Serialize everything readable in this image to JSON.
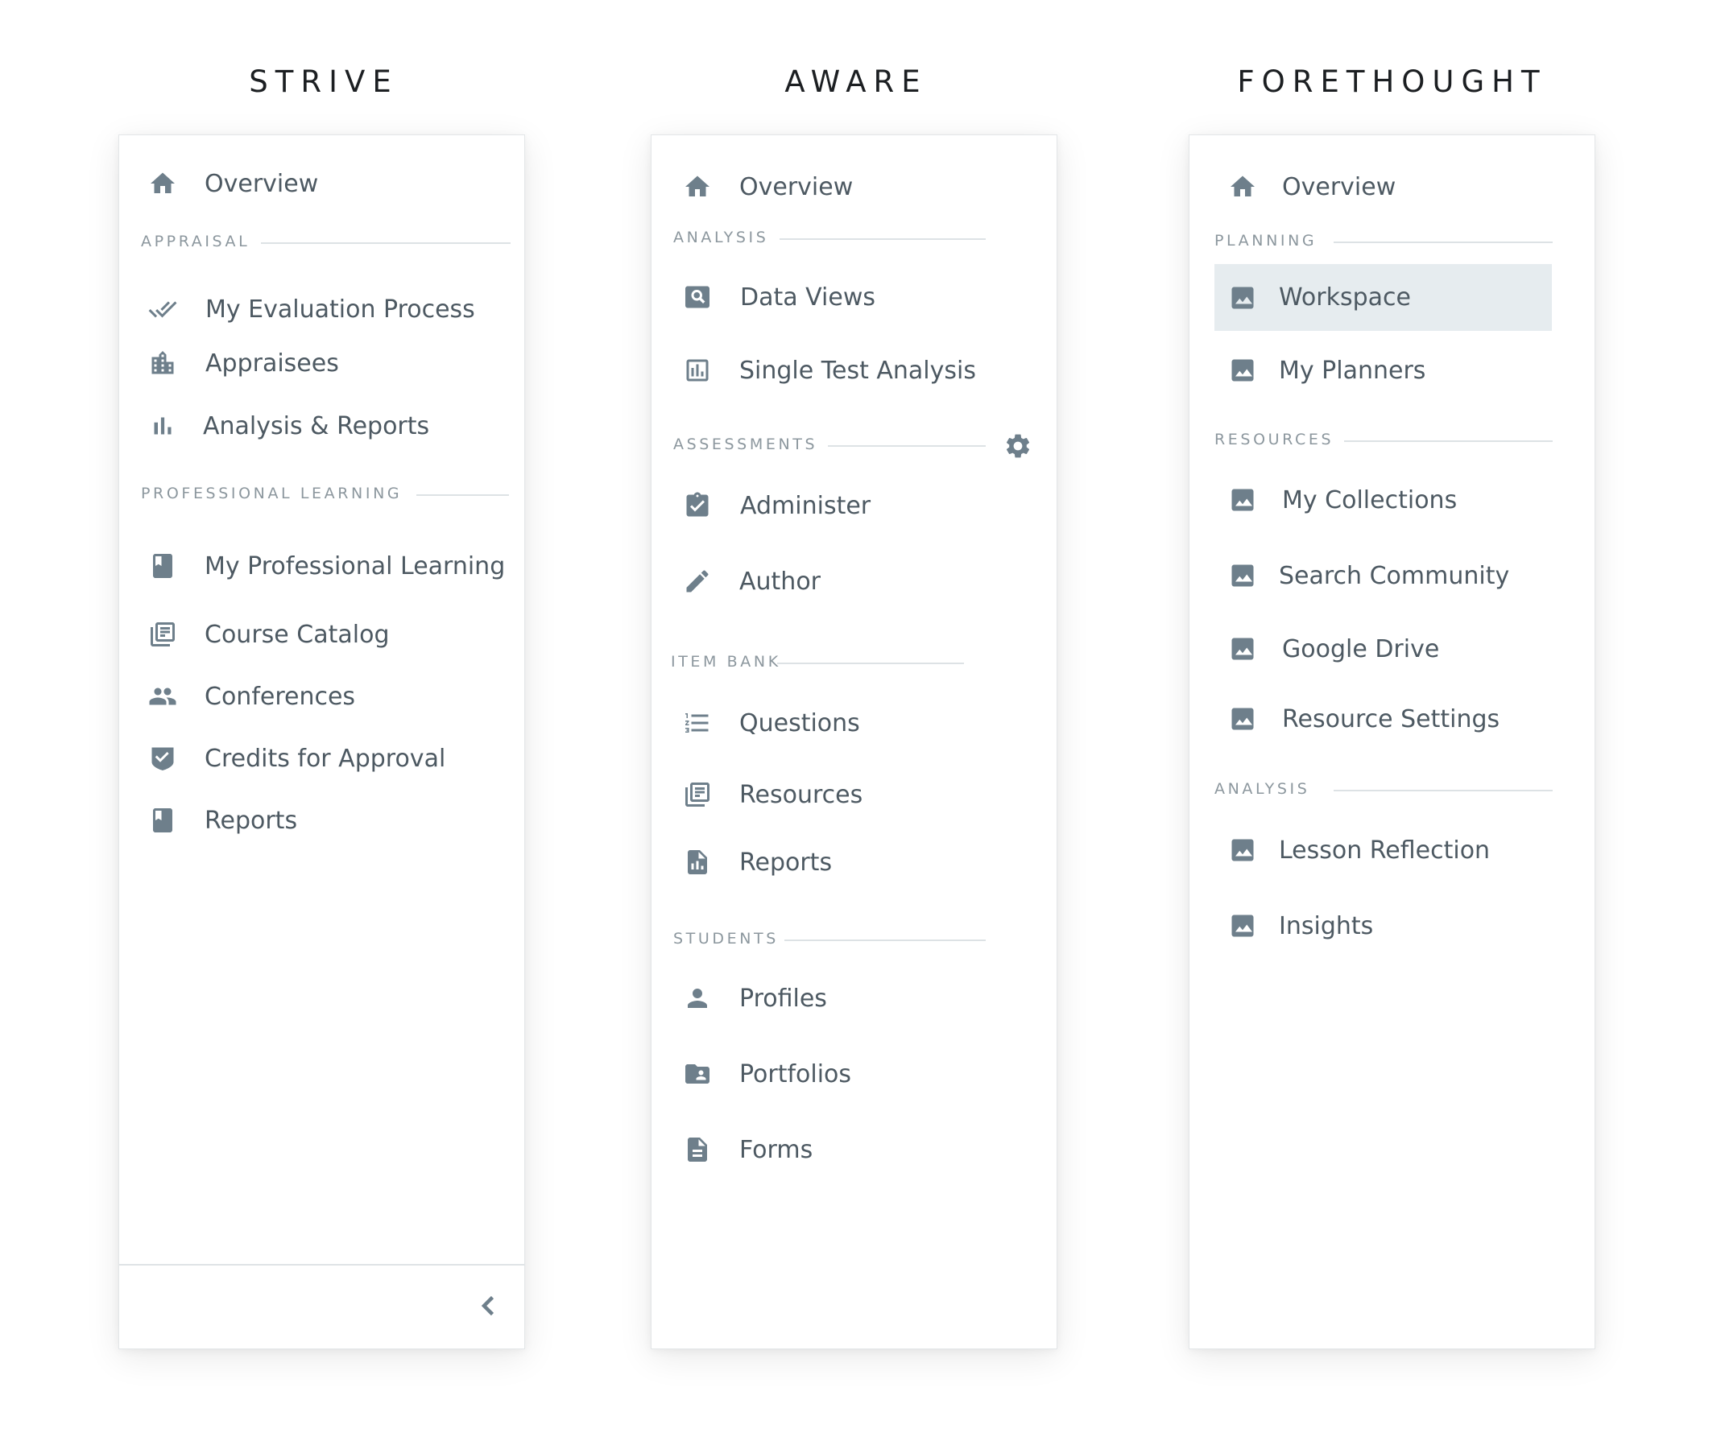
{
  "columns": [
    {
      "title": "STRIVE",
      "overview": "Overview",
      "sections": [
        {
          "title": "APPRAISAL",
          "items": [
            "My Evaluation Process",
            "Appraisees",
            "Analysis & Reports"
          ]
        },
        {
          "title": "PROFESSIONAL LEARNING",
          "items": [
            "My Professional Learning",
            "Course Catalog",
            "Conferences",
            "Credits for Approval",
            "Reports"
          ]
        }
      ],
      "icons": [
        "home-icon",
        "double-check-icon",
        "building-icon",
        "bar-chart-icon",
        "book-icon",
        "library-icon",
        "people-icon",
        "verified-icon",
        "book-icon"
      ],
      "collapse_icon": "chevron-left-icon"
    },
    {
      "title": "AWARE",
      "overview": "Overview",
      "sections": [
        {
          "title": "ANALYSIS",
          "items": [
            "Data Views",
            "Single Test Analysis"
          ]
        },
        {
          "title": "ASSESSMENTS",
          "items": [
            "Administer",
            "Author"
          ]
        },
        {
          "title": "ITEM BANK",
          "items": [
            "Questions",
            "Resources",
            "Reports"
          ]
        },
        {
          "title": "STUDENTS",
          "items": [
            "Profiles",
            "Portfolios",
            "Forms"
          ]
        }
      ],
      "icons": [
        "home-icon",
        "search-box-icon",
        "chart-box-icon",
        "clipboard-check-icon",
        "pencil-icon",
        "list-icon",
        "library-icon",
        "document-icon",
        "person-icon",
        "folder-user-icon",
        "form-icon"
      ],
      "settings_icon": "gear-icon"
    },
    {
      "title": "FORETHOUGHT",
      "overview": "Overview",
      "sections": [
        {
          "title": "PLANNING",
          "items": [
            "Workspace",
            "My Planners"
          ]
        },
        {
          "title": "RESOURCES",
          "items": [
            "My Collections",
            "Search Community",
            "Google Drive",
            "Resource Settings"
          ]
        },
        {
          "title": "ANALYSIS",
          "items": [
            "Lesson Reflection",
            "Insights"
          ]
        }
      ],
      "selected_item": "Workspace",
      "icons": [
        "home-icon",
        "image-icon"
      ]
    }
  ],
  "colors": {
    "icon": "#6e7f8b",
    "text": "#4d5962",
    "section": "#8c979e",
    "selected_bg": "#e6ecef"
  }
}
